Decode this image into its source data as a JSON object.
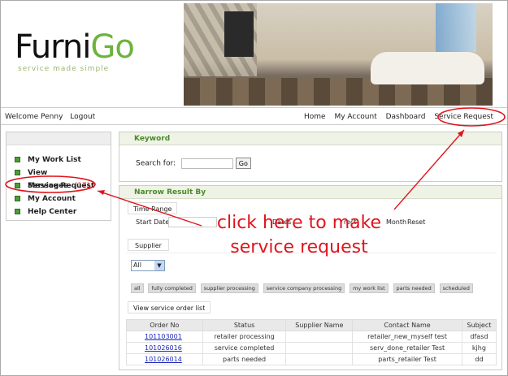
{
  "logo": {
    "name_start": "Furni",
    "name_end": "Go",
    "tagline": "service made simple"
  },
  "topnav": {
    "welcome": "Welcome Penny",
    "logout": "Logout",
    "links": [
      "Home",
      "My Account",
      "Dashboard",
      "Service Request"
    ]
  },
  "sidebar": {
    "items": [
      {
        "label": "My Work List"
      },
      {
        "label": "View Messages",
        "count": "(17)"
      },
      {
        "label": "Service Request"
      },
      {
        "label": "My Account"
      },
      {
        "label": "Help Center"
      }
    ]
  },
  "keyword": {
    "title": "Keyword",
    "search_label": "Search for:",
    "go": "Go"
  },
  "narrow": {
    "title": "Narrow Result By",
    "time_range": "Time Range",
    "start_date": "Start Date:",
    "date_partial": "Dates",
    "direct_partial": "rect",
    "month": "Month",
    "reset": "Reset",
    "supplier": "Supplier",
    "supplier_selected": "All",
    "filters": [
      "all",
      "fully completed",
      "supplier processing",
      "service company processing",
      "my work list",
      "parts needed",
      "scheduled"
    ],
    "tab": "View service order list"
  },
  "table": {
    "headers": [
      "Order No",
      "Status",
      "Supplier Name",
      "Contact Name",
      "Subject"
    ],
    "rows": [
      [
        "101103001",
        "retailer processing",
        "",
        "retailer_new_myself test",
        "dfasd"
      ],
      [
        "101026016",
        "service completed",
        "",
        "serv_done_retailer Test",
        "kjhg"
      ],
      [
        "101026014",
        "parts needed",
        "",
        "parts_retailer Test",
        "dd"
      ]
    ]
  },
  "annotation": {
    "line1": "click here to make",
    "line2": "service request",
    "color": "#e1141d"
  }
}
